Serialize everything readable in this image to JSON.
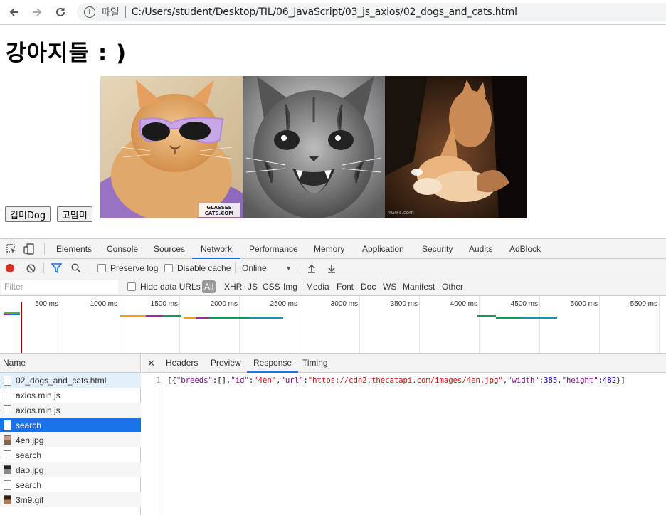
{
  "browser": {
    "scheme_label": "파일",
    "url": "C:/Users/student/Desktop/TIL/06_JavaScript/03_js_axios/02_dogs_and_cats.html"
  },
  "page": {
    "title": "강아지들 : )",
    "buttons": {
      "dog": "깁미Dog",
      "cat": "고맘미"
    },
    "images": [
      {
        "name": "cat-with-sunglasses",
        "watermark": "GLASSES CATS.COM"
      },
      {
        "name": "screaming-kitten"
      },
      {
        "name": "cats-playing",
        "watermark": "4GIFs.com"
      }
    ]
  },
  "devtools": {
    "tabs": [
      "Elements",
      "Console",
      "Sources",
      "Network",
      "Performance",
      "Memory",
      "Application",
      "Security",
      "Audits",
      "AdBlock"
    ],
    "active_tab": "Network",
    "toolbar": {
      "preserve_log": "Preserve log",
      "disable_cache": "Disable cache",
      "throttle": "Online"
    },
    "filter": {
      "placeholder": "Filter",
      "hide_data_urls": "Hide data URLs",
      "types": [
        "All",
        "XHR",
        "JS",
        "CSS",
        "Img",
        "Media",
        "Font",
        "Doc",
        "WS",
        "Manifest",
        "Other"
      ]
    },
    "timeline_ticks": [
      "500 ms",
      "1000 ms",
      "1500 ms",
      "2000 ms",
      "2500 ms",
      "3000 ms",
      "3500 ms",
      "4000 ms",
      "4500 ms",
      "5000 ms",
      "5500 ms"
    ],
    "requests_header": "Name",
    "requests": [
      {
        "name": "02_dogs_and_cats.html",
        "kind": "doc"
      },
      {
        "name": "axios.min.js",
        "kind": "doc"
      },
      {
        "name": "axios.min.js",
        "kind": "doc"
      },
      {
        "name": "search",
        "kind": "doc",
        "selected": true
      },
      {
        "name": "4en.jpg",
        "kind": "img"
      },
      {
        "name": "search",
        "kind": "doc"
      },
      {
        "name": "dao.jpg",
        "kind": "img"
      },
      {
        "name": "search",
        "kind": "doc"
      },
      {
        "name": "3m9.gif",
        "kind": "img"
      }
    ],
    "detail_tabs": [
      "Headers",
      "Preview",
      "Response",
      "Timing"
    ],
    "active_detail_tab": "Response",
    "response": {
      "line_number": "1",
      "code": "[{\"breeds\":[],\"id\":\"4en\",\"url\":\"https://cdn2.thecatapi.com/images/4en.jpg\",\"width\":385,\"height\":482}]"
    },
    "colors": {
      "accent": "#1a73e8",
      "record": "#d93025"
    }
  }
}
